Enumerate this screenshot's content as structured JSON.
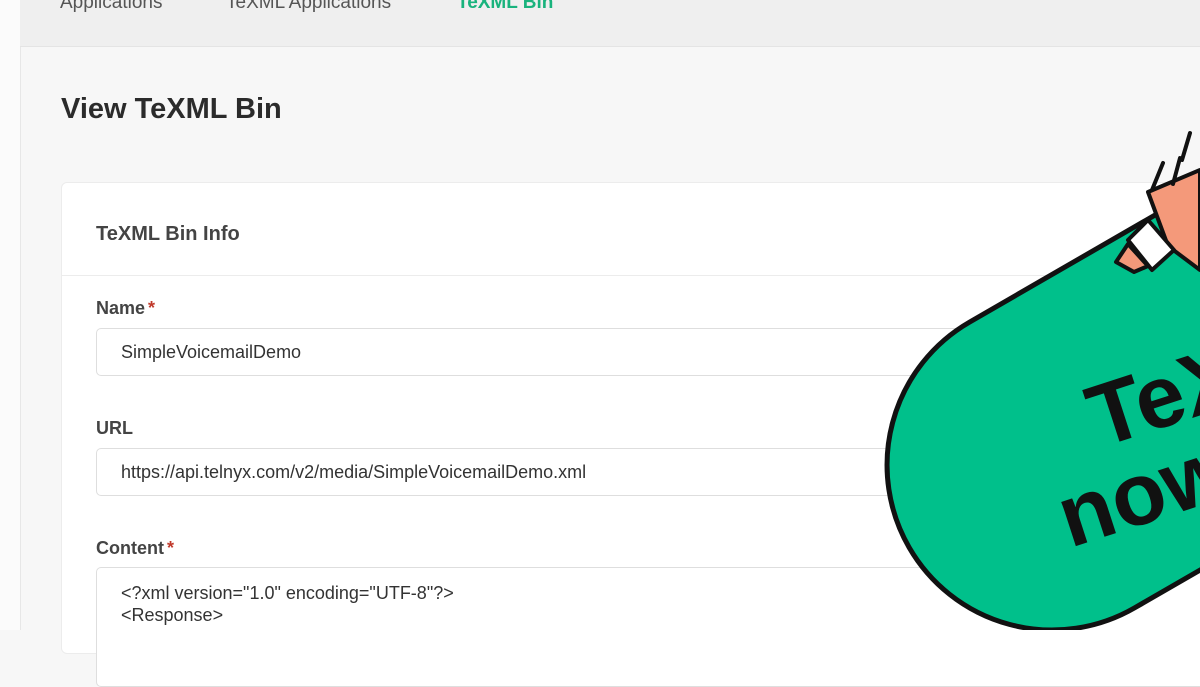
{
  "tabs": [
    {
      "label": "Applications",
      "active": false
    },
    {
      "label": "TeXML Applications",
      "active": false
    },
    {
      "label": "TeXML Bin",
      "active": true
    }
  ],
  "page": {
    "title": "View TeXML Bin"
  },
  "card": {
    "title": "TeXML Bin Info"
  },
  "form": {
    "name_label": "Name",
    "name_value": "SimpleVoicemailDemo",
    "url_label": "URL",
    "url_value": "https://api.telnyx.com/v2/media/SimpleVoicemailDemo.xml",
    "content_label": "Content",
    "required_mark": "*",
    "content_lines": [
      "<?xml version=\"1.0\" encoding=\"UTF-8\"?>",
      "<Response>"
    ]
  },
  "badge": {
    "line1": "TeXM",
    "line2": "now",
    "color": "#00c08b",
    "accent": "#f4997a"
  },
  "colors": {
    "active_tab": "#19b37d",
    "required": "#c0392b"
  }
}
